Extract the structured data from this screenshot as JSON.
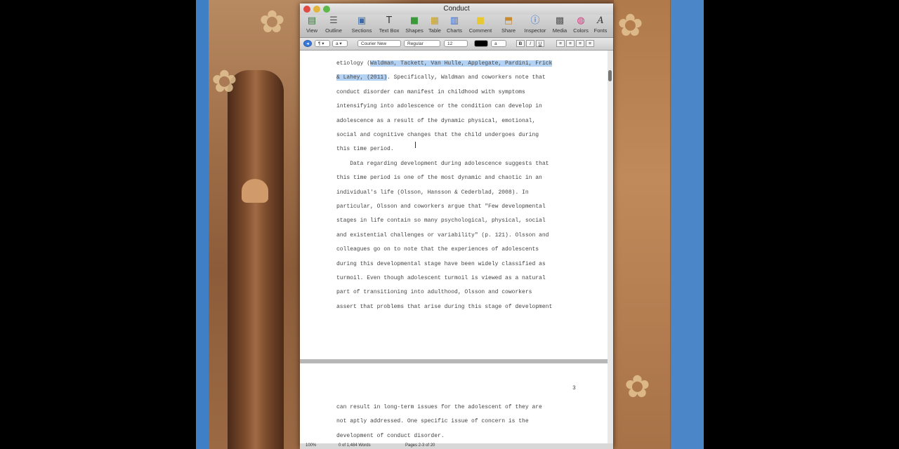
{
  "window": {
    "title": "Conduct"
  },
  "toolbar": {
    "items": [
      {
        "label": "View",
        "icon": "view-icon"
      },
      {
        "label": "Outline",
        "icon": "outline-icon"
      },
      {
        "label": "Sections",
        "icon": "sections-icon"
      },
      {
        "label": "Text Box",
        "icon": "textbox-icon"
      },
      {
        "label": "Shapes",
        "icon": "shapes-icon"
      },
      {
        "label": "Table",
        "icon": "table-icon"
      },
      {
        "label": "Charts",
        "icon": "charts-icon"
      },
      {
        "label": "Comment",
        "icon": "comment-icon"
      },
      {
        "label": "Share",
        "icon": "share-icon"
      },
      {
        "label": "Inspector",
        "icon": "inspector-icon"
      },
      {
        "label": "Media",
        "icon": "media-icon"
      },
      {
        "label": "Colors",
        "icon": "colors-icon"
      },
      {
        "label": "Fonts",
        "icon": "fonts-icon"
      }
    ]
  },
  "format": {
    "font": "Courier New",
    "style": "Regular",
    "size": "12",
    "bold": "B",
    "italic": "I",
    "underline": "U",
    "a_label": "a"
  },
  "page1": {
    "lines": [
      {
        "pre": "etiology (",
        "sel": "Waldman, Tackett, Van Hulle, Applegate, Pardini, Frick",
        "post": ""
      },
      {
        "pre": "",
        "sel": "& Lahey, (2011)",
        "post": ". Specifically, Waldman and coworkers note that"
      },
      {
        "pre": "conduct disorder can manifest in childhood with symptoms",
        "sel": "",
        "post": ""
      },
      {
        "pre": "intensifying into adolescence or the condition can develop in",
        "sel": "",
        "post": ""
      },
      {
        "pre": "adolescence as a result of the dynamic physical, emotional,",
        "sel": "",
        "post": ""
      },
      {
        "pre": "social and cognitive changes that the child undergoes during",
        "sel": "",
        "post": ""
      },
      {
        "pre": "this time period.",
        "sel": "",
        "post": ""
      },
      {
        "pre": "    Data regarding development during adolescence suggests that",
        "sel": "",
        "post": ""
      },
      {
        "pre": "this time period is one of the most dynamic and chaotic in an",
        "sel": "",
        "post": ""
      },
      {
        "pre": "individual's life (Olsson, Hansson & Cederblad, 2008). In",
        "sel": "",
        "post": ""
      },
      {
        "pre": "particular, Olsson and coworkers argue that \"Few developmental",
        "sel": "",
        "post": ""
      },
      {
        "pre": "stages in life contain so many psychological, physical, social",
        "sel": "",
        "post": ""
      },
      {
        "pre": "and existential challenges or variability\" (p. 121). Olsson and",
        "sel": "",
        "post": ""
      },
      {
        "pre": "colleagues go on to note that the experiences of adolescents",
        "sel": "",
        "post": ""
      },
      {
        "pre": "during this developmental stage have been widely classified as",
        "sel": "",
        "post": ""
      },
      {
        "pre": "turmoil. Even though adolescent turmoil is viewed as a natural",
        "sel": "",
        "post": ""
      },
      {
        "pre": "part of transitioning into adulthood, Olsson and coworkers",
        "sel": "",
        "post": ""
      },
      {
        "pre": "assert that problems that arise during this stage of development",
        "sel": "",
        "post": ""
      }
    ]
  },
  "page2": {
    "page_number": "3",
    "lines": [
      "can result in long-term issues for the adolescent of they are",
      "not aptly addressed. One specific issue of concern is the",
      "development of conduct disorder."
    ]
  },
  "status": {
    "zoom": "100%",
    "words": "0 of 1,484 Words",
    "pages": "Pages 2-3 of 20"
  },
  "colors": {
    "selection": "#b4d3f4",
    "desktop_blue": "#3f7fc5"
  }
}
